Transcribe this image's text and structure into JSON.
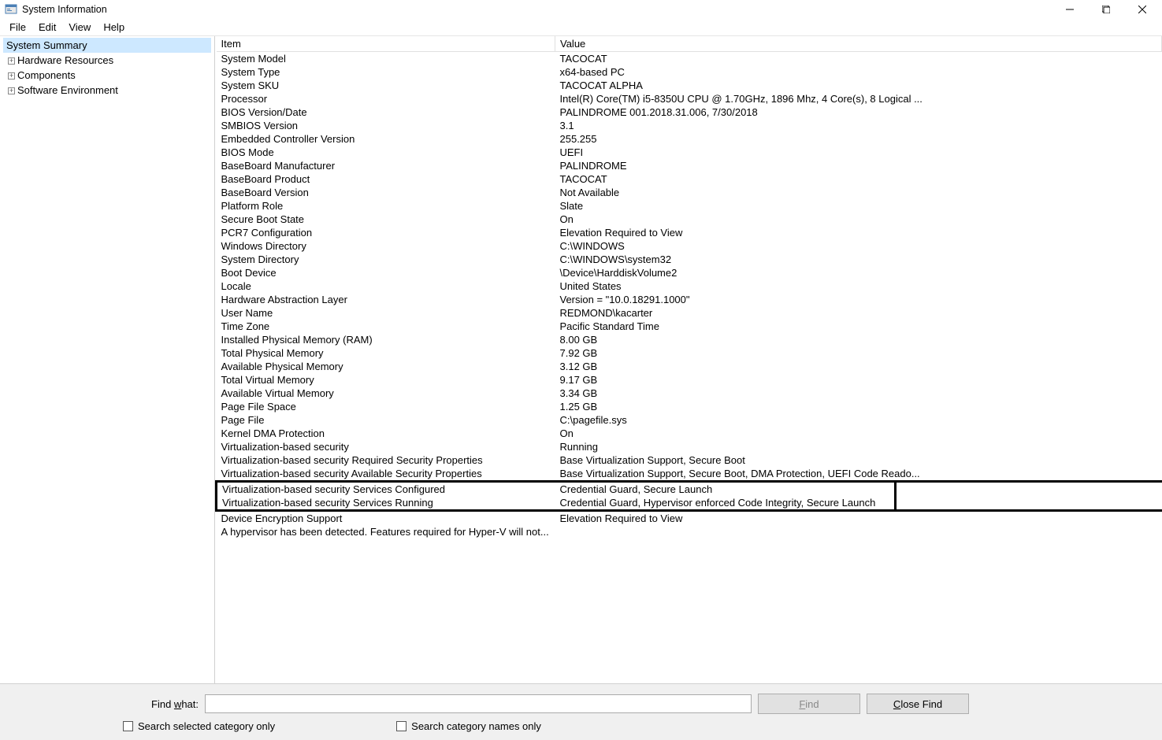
{
  "window": {
    "title": "System Information"
  },
  "menu": {
    "file": "File",
    "edit": "Edit",
    "view": "View",
    "help": "Help"
  },
  "tree": {
    "root": "System Summary",
    "items": [
      "Hardware Resources",
      "Components",
      "Software Environment"
    ]
  },
  "columns": {
    "item": "Item",
    "value": "Value"
  },
  "rows": [
    {
      "item": "System Model",
      "value": "TACOCAT"
    },
    {
      "item": "System Type",
      "value": "x64-based PC"
    },
    {
      "item": "System SKU",
      "value": "TACOCAT ALPHA"
    },
    {
      "item": "Processor",
      "value": "Intel(R) Core(TM) i5-8350U CPU @ 1.70GHz, 1896 Mhz, 4 Core(s), 8 Logical ..."
    },
    {
      "item": "BIOS Version/Date",
      "value": "PALINDROME 001.2018.31.006, 7/30/2018"
    },
    {
      "item": "SMBIOS Version",
      "value": "3.1"
    },
    {
      "item": "Embedded Controller Version",
      "value": "255.255"
    },
    {
      "item": "BIOS Mode",
      "value": "UEFI"
    },
    {
      "item": "BaseBoard Manufacturer",
      "value": "PALINDROME"
    },
    {
      "item": "BaseBoard Product",
      "value": "TACOCAT"
    },
    {
      "item": "BaseBoard Version",
      "value": "Not Available"
    },
    {
      "item": "Platform Role",
      "value": "Slate"
    },
    {
      "item": "Secure Boot State",
      "value": "On"
    },
    {
      "item": "PCR7 Configuration",
      "value": "Elevation Required to View"
    },
    {
      "item": "Windows Directory",
      "value": "C:\\WINDOWS"
    },
    {
      "item": "System Directory",
      "value": "C:\\WINDOWS\\system32"
    },
    {
      "item": "Boot Device",
      "value": "\\Device\\HarddiskVolume2"
    },
    {
      "item": "Locale",
      "value": "United States"
    },
    {
      "item": "Hardware Abstraction Layer",
      "value": "Version = \"10.0.18291.1000\""
    },
    {
      "item": "User Name",
      "value": "REDMOND\\kacarter"
    },
    {
      "item": "Time Zone",
      "value": "Pacific Standard Time"
    },
    {
      "item": "Installed Physical Memory (RAM)",
      "value": "8.00 GB"
    },
    {
      "item": "Total Physical Memory",
      "value": "7.92 GB"
    },
    {
      "item": "Available Physical Memory",
      "value": "3.12 GB"
    },
    {
      "item": "Total Virtual Memory",
      "value": "9.17 GB"
    },
    {
      "item": "Available Virtual Memory",
      "value": "3.34 GB"
    },
    {
      "item": "Page File Space",
      "value": "1.25 GB"
    },
    {
      "item": "Page File",
      "value": "C:\\pagefile.sys"
    },
    {
      "item": "Kernel DMA Protection",
      "value": "On"
    },
    {
      "item": "Virtualization-based security",
      "value": "Running"
    },
    {
      "item": "Virtualization-based security Required Security Properties",
      "value": "Base Virtualization Support, Secure Boot"
    },
    {
      "item": "Virtualization-based security Available Security Properties",
      "value": "Base Virtualization Support, Secure Boot, DMA Protection, UEFI Code Reado..."
    },
    {
      "item": "Virtualization-based security Services Configured",
      "value": "Credential Guard, Secure Launch",
      "highlight": true
    },
    {
      "item": "Virtualization-based security Services Running",
      "value": "Credential Guard, Hypervisor enforced Code Integrity, Secure Launch",
      "highlight": true
    },
    {
      "item": "Device Encryption Support",
      "value": "Elevation Required to View"
    },
    {
      "item": "A hypervisor has been detected. Features required for Hyper-V will not...",
      "value": ""
    }
  ],
  "footer": {
    "find_label_pre": "Find ",
    "find_label_u": "w",
    "find_label_post": "hat:",
    "find_button": "Find",
    "close_find_button": "Close Find",
    "check1": "Search selected category only",
    "check2": "Search category names only"
  }
}
